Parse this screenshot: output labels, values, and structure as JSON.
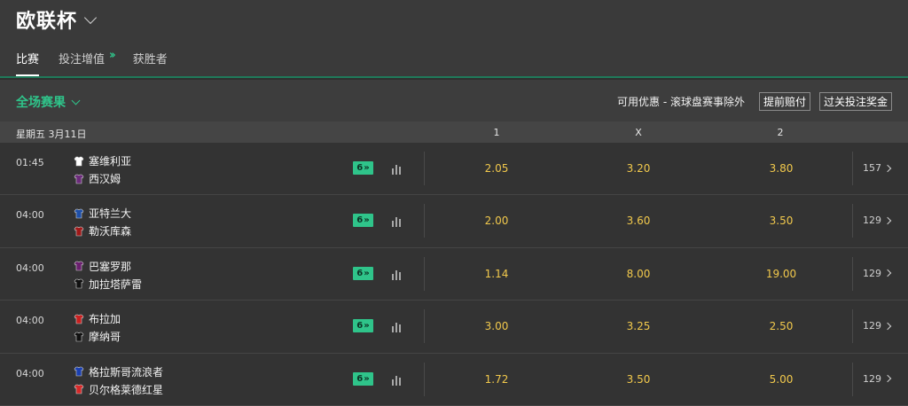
{
  "header": {
    "title": "欧联杯",
    "tabs": [
      {
        "label": "比赛",
        "active": true
      },
      {
        "label": "投注增值",
        "active": false,
        "icon": "double-chevron-right-icon"
      },
      {
        "label": "获胜者",
        "active": false
      }
    ]
  },
  "section": {
    "title": "全场赛果",
    "promo_text": "可用优惠 - 滚球盘赛事除外",
    "buttons": [
      "提前赔付",
      "过关投注奖金"
    ]
  },
  "table": {
    "date": "星期五 3月11日",
    "columns": [
      "1",
      "X",
      "2"
    ],
    "rows": [
      {
        "time": "01:45",
        "home": "塞维利亚",
        "away": "西汉姆",
        "home_kit": "#ffffff",
        "away_kit": "#6b2a7a",
        "markets": "6",
        "odds": [
          "2.05",
          "3.20",
          "3.80"
        ],
        "more": "157"
      },
      {
        "time": "04:00",
        "home": "亚特兰大",
        "away": "勒沃库森",
        "home_kit": "#1e4fa8",
        "away_kit": "#a01818",
        "markets": "6",
        "odds": [
          "2.00",
          "3.60",
          "3.50"
        ],
        "more": "129"
      },
      {
        "time": "04:00",
        "home": "巴塞罗那",
        "away": "加拉塔萨雷",
        "home_kit": "#6a1f6e",
        "away_kit": "#111111",
        "markets": "6",
        "odds": [
          "1.14",
          "8.00",
          "19.00"
        ],
        "more": "129"
      },
      {
        "time": "04:00",
        "home": "布拉加",
        "away": "摩纳哥",
        "home_kit": "#c81f1f",
        "away_kit": "#111111",
        "markets": "6",
        "odds": [
          "3.00",
          "3.25",
          "2.50"
        ],
        "more": "129"
      },
      {
        "time": "04:00",
        "home": "格拉斯哥流浪者",
        "away": "贝尔格莱德红星",
        "home_kit": "#1a3fb0",
        "away_kit": "#d62828",
        "markets": "6",
        "odds": [
          "1.72",
          "3.50",
          "5.00"
        ],
        "more": "129"
      }
    ]
  },
  "colors": {
    "accent": "#2fc48a",
    "odds": "#f2c94c",
    "background": "#2f2f2f"
  }
}
